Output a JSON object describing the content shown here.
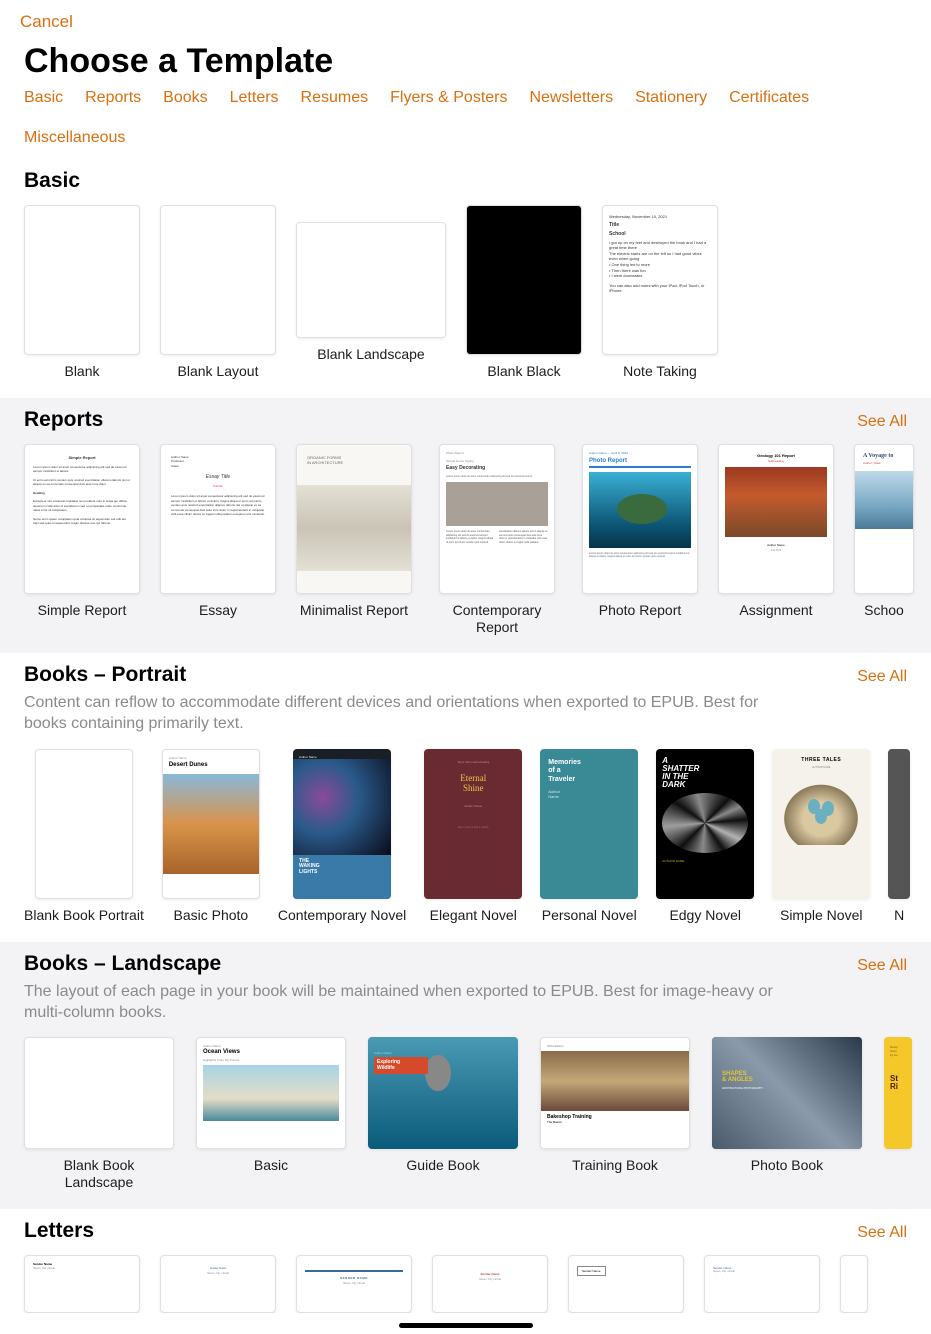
{
  "cancel": "Cancel",
  "title": "Choose a Template",
  "tabs": [
    "Basic",
    "Reports",
    "Books",
    "Letters",
    "Resumes",
    "Flyers & Posters",
    "Newsletters",
    "Stationery",
    "Certificates",
    "Miscellaneous"
  ],
  "see_all": "See All",
  "sections": {
    "basic": {
      "title": "Basic",
      "items": [
        "Blank",
        "Blank Layout",
        "Blank Landscape",
        "Blank Black",
        "Note Taking"
      ]
    },
    "reports": {
      "title": "Reports",
      "items": [
        "Simple Report",
        "Essay",
        "Minimalist Report",
        "Contemporary Report",
        "Photo Report",
        "Assignment",
        "School Report"
      ]
    },
    "books_portrait": {
      "title": "Books – Portrait",
      "desc": "Content can reflow to accommodate different devices and orientations when exported to EPUB. Best for books containing primarily text.",
      "items": [
        "Blank Book Portrait",
        "Basic Photo",
        "Contemporary Novel",
        "Elegant Novel",
        "Personal Novel",
        "Edgy Novel",
        "Simple Novel",
        "N"
      ]
    },
    "books_landscape": {
      "title": "Books – Landscape",
      "desc": "The layout of each page in your book will be maintained when exported to EPUB. Best for image-heavy or multi-column books.",
      "items": [
        "Blank Book Landscape",
        "Basic",
        "Guide Book",
        "Training Book",
        "Photo Book"
      ]
    },
    "letters": {
      "title": "Letters"
    }
  },
  "thumbs": {
    "note": {
      "date": "Wednesday, November 10, 2021",
      "title": "Title",
      "subject": "School",
      "b1": "I got up on my feet and destroyed the book and I had a great time there",
      "b2": "The electric stairs are on the left so I had good vibes even when going",
      "b3": "One thing led to more",
      "b4": "Then there was fun",
      "b5": "I went downstairs",
      "foot": "You can also add notes with your iPad, iPod Touch, or iPhone."
    },
    "simple_report": {
      "hd": "Simple Report"
    },
    "essay": {
      "hd": "Essay Title",
      "sub": "Subtitle"
    },
    "minreport": {
      "l1": "ORGANIC FORMS",
      "l2": "IN ARCHITECTURE"
    },
    "contemp": {
      "l1": "Simple Home Styling",
      "l2": "Easy Decorating"
    },
    "photoreport": {
      "meta": "Author Name — April 8, 2022",
      "hd": "Photo Report"
    },
    "assignment": {
      "hd": "Geology 101 Report",
      "sub": "Subheading",
      "by": "Author Name",
      "date": "Fall 2024"
    },
    "school": {
      "hd": "A Voyage to"
    },
    "bp_photo": {
      "auth": "Author Name",
      "ttl": "Desert Dunes"
    },
    "bp_contemp": {
      "auth": "Author Name",
      "ttl1": "THE",
      "ttl2": "WAKING",
      "ttl3": "LIGHTS"
    },
    "bp_elegant": {
      "tap": "Tap or click to add a heading",
      "ttl1": "Eternal",
      "ttl2": "Shine",
      "auth": "Author Name",
      "sub": "Tap or click to add a subtitle"
    },
    "bp_personal": {
      "ttl1": "Memories",
      "ttl2": "of a",
      "ttl3": "Traveler",
      "auth1": "Author",
      "auth2": "Name"
    },
    "bp_edgy": {
      "ttl1": "A",
      "ttl2": "SHATTER",
      "ttl3": "IN THE",
      "ttl4": "DARK",
      "auth": "AUTHOR NAME"
    },
    "bp_simple": {
      "ttl": "THREE TALES",
      "auth": "AUTHOR NAME"
    },
    "bl_basic": {
      "auth": "Author Name",
      "ttl": "Ocean Views",
      "sub": "Highlights From My Travels"
    },
    "bl_guide": {
      "auth": "Author Name",
      "ttl1": "Exploring",
      "ttl2": "Wildlife"
    },
    "bl_training": {
      "ed": "2024 Edition",
      "ttl": "Bakeshop Training",
      "sub": "The Basics"
    },
    "bl_photo": {
      "ttl1": "SHAPES",
      "ttl2": "& ANGLES",
      "sub": "ARCHITECTURAL PHOTOGRAPHY"
    },
    "bl_cut": {
      "a": "Recip",
      "b": "Sous",
      "c": "by Au",
      "d": "St",
      "e": "Ri"
    },
    "letters": {
      "sender": "Sender Name",
      "SENDER": "SENDER NAME"
    }
  }
}
